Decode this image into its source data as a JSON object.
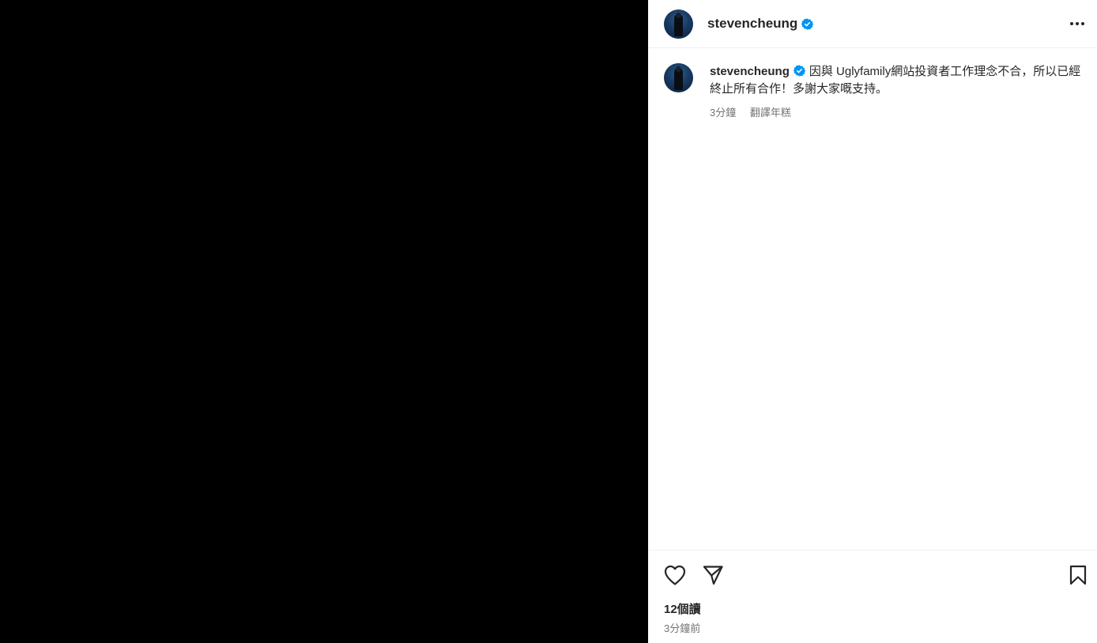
{
  "post": {
    "author": "stevencheung",
    "caption": {
      "username": "stevencheung",
      "text": "因與 Uglyfamily網站投資者工作理念不合，所以已經終止所有合作！多謝大家嘅支持。",
      "time": "3分鐘",
      "translate_label": "翻譯年糕"
    },
    "views_label": "12個讀",
    "posted_label": "3分鐘前"
  },
  "colors": {
    "verified": "#0095f6",
    "text": "#262626",
    "secondary": "#737373",
    "media_background": "#000000"
  },
  "icons": {
    "more": "more-horizontal-icon",
    "verified": "verified-badge-icon",
    "like": "heart-icon",
    "share": "send-icon",
    "save": "bookmark-icon"
  }
}
